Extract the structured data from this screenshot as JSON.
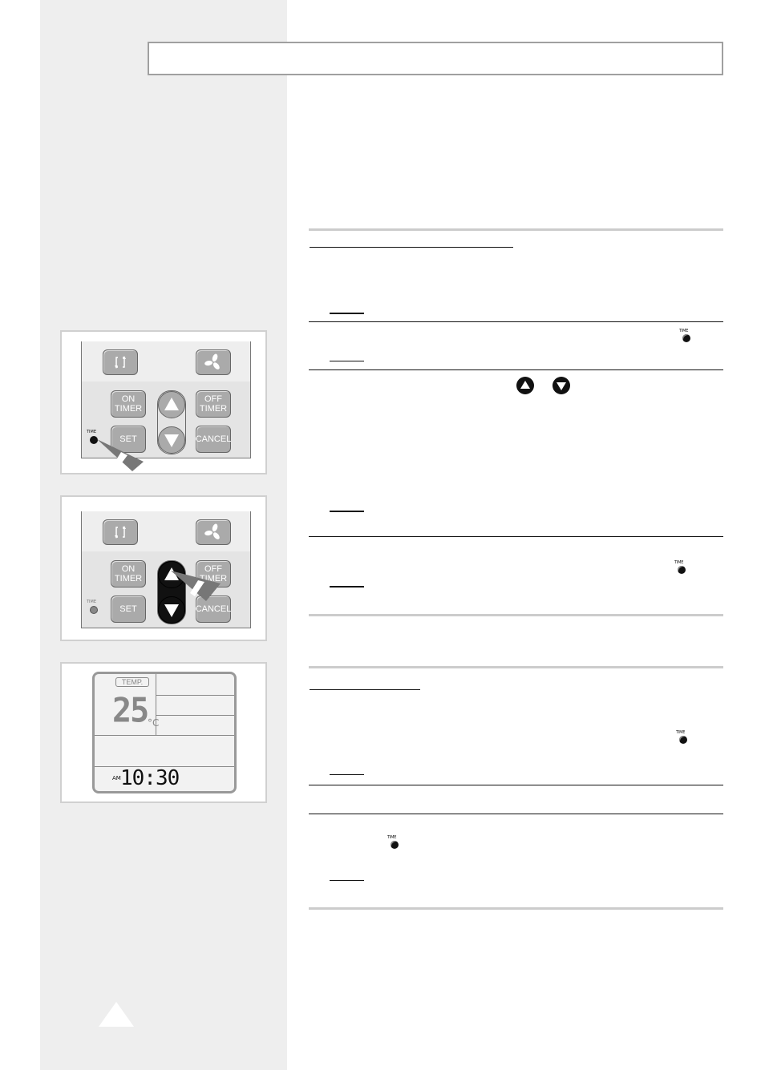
{
  "page": {
    "header_title": "",
    "page_marker": "triangle"
  },
  "icons": {
    "time_label": "TIME"
  },
  "remote_1": {
    "mode_icon": "mode-cycle-icon",
    "fan_icon": "fan-icon",
    "on_timer": "ON\nTIMER",
    "off_timer": "OFF\nTIMER",
    "set": "SET",
    "cancel": "CANCEL",
    "time_label": "TIME",
    "highlighted": "time-button"
  },
  "remote_2": {
    "mode_icon": "mode-cycle-icon",
    "fan_icon": "fan-icon",
    "on_timer": "ON\nTIMER",
    "off_timer": "OFF\nTIMER",
    "set": "SET",
    "cancel": "CANCEL",
    "time_label": "TIME",
    "highlighted": "up-down-buttons"
  },
  "display": {
    "temp_label": "TEMP.",
    "temperature": "25",
    "unit": "°C",
    "am_pm": "AM",
    "clock": "10:30"
  },
  "sections": [
    {
      "steps": 2
    },
    {
      "steps": 3
    },
    {
      "steps": 2
    }
  ]
}
